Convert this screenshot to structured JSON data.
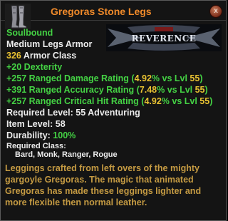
{
  "tooltip": {
    "title": "Gregoras Stone Legs",
    "close_glyph": "x",
    "guild_banner_text": "REVERENCE",
    "soulbound": "Soulbound",
    "type": "Medium Legs Armor",
    "armor_value": "326",
    "armor_label": " Armor Class",
    "stats": [
      "+20 Dexterity",
      {
        "label": "+257 Ranged Damage Rating (",
        "pct": "4.92",
        "mid": "% vs Lvl ",
        "lvl": "55",
        "end": ")"
      },
      {
        "label": "+391 Ranged Accuracy Rating (",
        "pct": "7.48",
        "mid": "% vs Lvl ",
        "lvl": "55",
        "end": ")"
      },
      {
        "label": "+257 Ranged Critical Hit Rating (",
        "pct": "4.92",
        "mid": "% vs Lvl ",
        "lvl": "55",
        "end": ")"
      }
    ],
    "required_level": "Required Level: 55 Adventuring",
    "item_level": "Item Level: 58",
    "durability_label": "Durability: ",
    "durability_value": "100%",
    "required_class_label": "Required Class:",
    "required_classes": "Bard, Monk, Ranger, Rogue",
    "description": "Leggings crafted from left overs of the mighty gargoyle Gregoras. The magic that animated Gregoras has made these leggings lighter and more flexible then normal leather."
  },
  "colors": {
    "title": "#f08a2a",
    "green": "#44d244",
    "gold": "#e8c232",
    "description": "#c49a42"
  },
  "icons": [
    "leg-armor-icon",
    "close-icon",
    "guild-banner"
  ]
}
